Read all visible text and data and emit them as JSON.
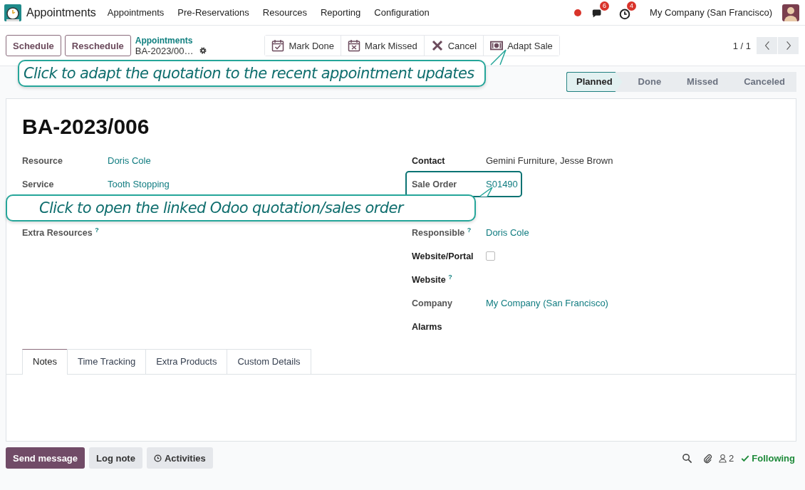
{
  "app": {
    "name": "Appointments"
  },
  "menu": [
    "Appointments",
    "Pre-Reservations",
    "Resources",
    "Reporting",
    "Configuration"
  ],
  "systray": {
    "messages_count": "6",
    "activities_count": "4",
    "company": "My Company (San Francisco)"
  },
  "control_panel": {
    "buttons": [
      "Schedule",
      "Reschedule"
    ],
    "breadcrumb": {
      "parent": "Appointments",
      "current": "BA-2023/00…"
    },
    "actions": [
      {
        "label": "Mark Done",
        "kind": "done"
      },
      {
        "label": "Mark Missed",
        "kind": "missed"
      },
      {
        "label": "Cancel",
        "kind": "cancel"
      },
      {
        "label": "Adapt Sale",
        "kind": "money"
      }
    ],
    "pager": "1 / 1"
  },
  "statusbar": [
    {
      "label": "Planned",
      "selected": true
    },
    {
      "label": "Done",
      "selected": false
    },
    {
      "label": "Missed",
      "selected": false
    },
    {
      "label": "Canceled",
      "selected": false
    }
  ],
  "tooltips": [
    "Click to adapt the quotation to the recent appointment updates",
    "Click to open the linked Odoo quotation/sales order"
  ],
  "record": {
    "title": "BA-2023/006",
    "left_fields": [
      {
        "label": "Resource",
        "bold": false,
        "kind": "link",
        "value": "Doris Cole"
      },
      {
        "label": "Service",
        "bold": false,
        "kind": "link",
        "value": "Tooth Stopping"
      },
      {
        "label": "Extra Resources $^{?}$",
        "bold": false,
        "kind": "empty"
      }
    ],
    "right_fields": [
      {
        "label": "Contact",
        "bold": true,
        "kind": "text",
        "value": "Gemini Furniture, Jesse Brown"
      },
      {
        "label": "Sale Order",
        "bold": false,
        "kind": "link",
        "value": "S01490",
        "highlighted": true
      },
      {
        "label": "Responsible $^{?}$",
        "bold": false,
        "kind": "link",
        "value": "Doris Cole"
      },
      {
        "label": "Website/Portal",
        "bold": true,
        "kind": "checkbox",
        "checked": false
      },
      {
        "label": "Website $^{?}$",
        "bold": true,
        "kind": "empty"
      },
      {
        "label": "Company",
        "bold": false,
        "kind": "link",
        "value": "My Company (San Francisco)"
      },
      {
        "label": "Alarms",
        "bold": true,
        "kind": "empty"
      }
    ]
  },
  "tabs": [
    {
      "label": "Notes",
      "selected": true
    },
    {
      "label": "Time Tracking",
      "selected": false
    },
    {
      "label": "Extra Products",
      "selected": false
    },
    {
      "label": "Custom Details",
      "selected": false
    }
  ],
  "chatter": {
    "buttons": [
      {
        "label": "Send message",
        "kind": "primary"
      },
      {
        "label": "Log note",
        "kind": "plain"
      },
      {
        "label": "Activities",
        "kind": "activities"
      }
    ],
    "followers_count": "2",
    "following": "Following"
  }
}
